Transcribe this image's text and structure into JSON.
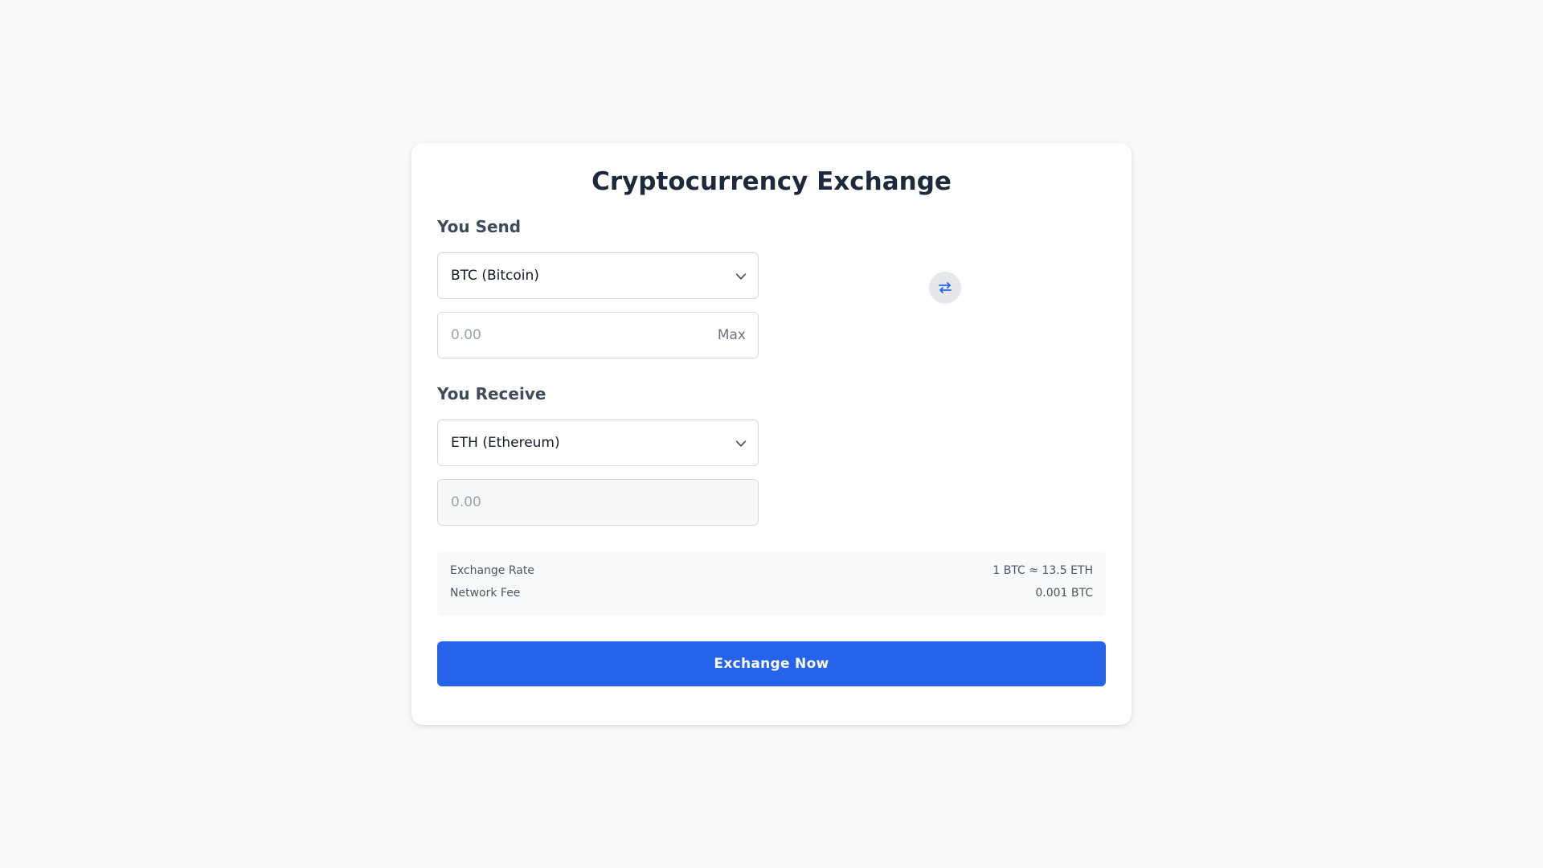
{
  "title": "Cryptocurrency Exchange",
  "send": {
    "label": "You Send",
    "currency": "BTC (Bitcoin)",
    "amount_placeholder": "0.00",
    "max_label": "Max"
  },
  "receive": {
    "label": "You Receive",
    "currency": "ETH (Ethereum)",
    "amount_placeholder": "0.00"
  },
  "info": {
    "rate_label": "Exchange Rate",
    "rate_value": "1 BTC ≈ 13.5 ETH",
    "fee_label": "Network Fee",
    "fee_value": "0.001 BTC"
  },
  "cta_label": "Exchange Now",
  "colors": {
    "accent": "#2563eb",
    "swap_icon": "#2563eb",
    "background": "#f8f9fb"
  },
  "icons": {
    "chevron": "chevron-down-icon",
    "swap": "swap-arrows-icon"
  }
}
